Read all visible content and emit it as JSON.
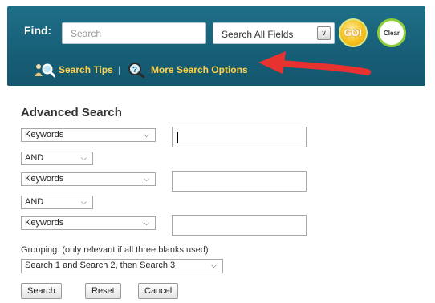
{
  "header": {
    "find_label": "Find:",
    "search_placeholder": "Search",
    "field_select_value": "Search All Fields",
    "go_label": "GO!",
    "clear_label": "Clear",
    "search_tips_label": "Search Tips",
    "divider": "|",
    "more_options_label": "More Search Options",
    "colors": {
      "header_bg": "#176078",
      "link": "#ffd24a",
      "arrow": "#e8322f"
    }
  },
  "advanced": {
    "title": "Advanced Search",
    "rows": [
      {
        "field": "Keywords",
        "value": ""
      },
      {
        "field": "Keywords",
        "value": ""
      },
      {
        "field": "Keywords",
        "value": ""
      }
    ],
    "operators": [
      "AND",
      "AND"
    ],
    "grouping_label": "Grouping: (only relevant if all three blanks used)",
    "grouping_value": "Search 1 and Search 2, then Search 3",
    "buttons": {
      "search": "Search",
      "reset": "Reset",
      "cancel": "Cancel"
    }
  },
  "icons": {
    "search_tips": "people-magnifier-icon",
    "more_options": "question-magnifier-icon",
    "dropdown": "chevron-down-icon",
    "annotation": "red-arrow-icon"
  }
}
